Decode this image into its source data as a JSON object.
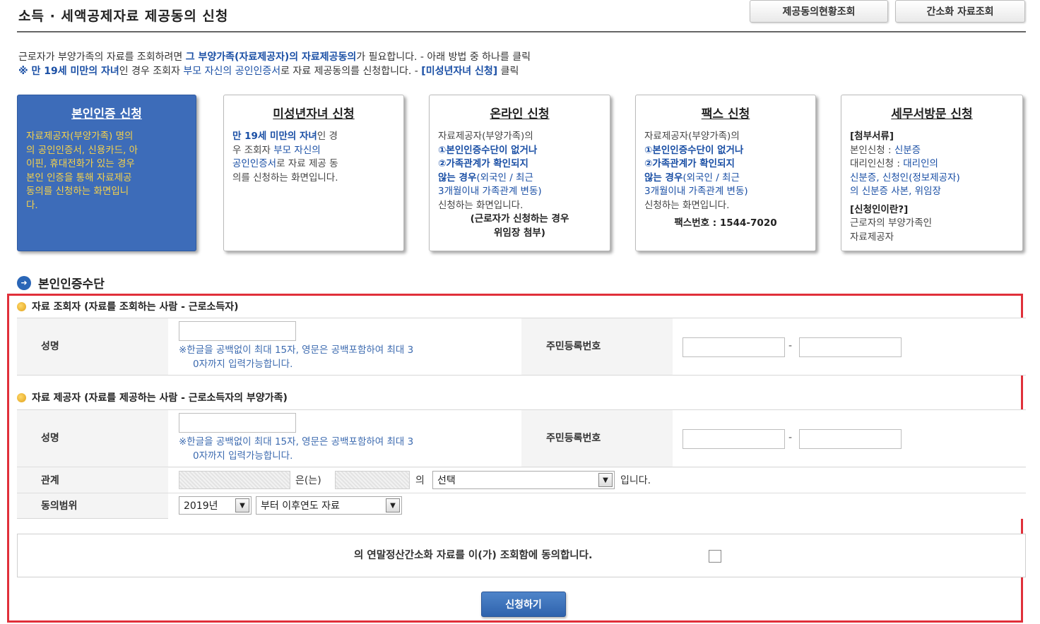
{
  "header": {
    "title": "소득 · 세액공제자료 제공동의 신청",
    "btn_status": "제공동의현황조회",
    "btn_simple": "간소화 자료조회"
  },
  "intro": {
    "line1_a": "근로자가 부양가족의 자료를 조회하려면 ",
    "line1_b": "그 부양가족(자료제공자)의 자료제공동의",
    "line1_c": "가 필요합니다. - 아래 방법 중 하나를 클릭",
    "line2_a": "※ 만 19세 미만의 자녀",
    "line2_b": "인 경우 조회자 ",
    "line2_c": "부모 자신의 공인인증서",
    "line2_d": "로 자료 제공동의를 신청합니다. - ",
    "line2_e": "[미성년자녀 신청]",
    "line2_f": " 클릭"
  },
  "cards": {
    "self": {
      "title": "본인인증 신청",
      "l1": "자료제공자(부양가족) 명의",
      "l2": "의 공인인증서, 신용카드, 아",
      "l3": "이핀, 휴대전화가 있는 경우",
      "l4": "본인 인증을 통해 자료제공",
      "l5": "동의를 신청하는 화면입니",
      "l6": "다."
    },
    "minor": {
      "title": "미성년자녀 신청",
      "l1a": "만 19세 미만의 자녀",
      "l1b": "인 경",
      "l2a": "우 조회자 ",
      "l2b": "부모 자신의",
      "l3a": "공인인증서",
      "l3b": "로 자료 제공 동",
      "l4": "의를 신청하는 화면입니다."
    },
    "online": {
      "title": "온라인 신청",
      "l1": "자료제공자(부양가족)의",
      "l2": "①본인인증수단이 없거나",
      "l3": "②가족관계가 확인되지",
      "l4a": "않는 경우",
      "l4b": "(외국인 / 최근",
      "l5": "3개월이내 가족관계 변동)",
      "l6": "신청하는 화면입니다.",
      "l7": "(근로자가 신청하는 경우",
      "l8": "위임장 첨부)"
    },
    "fax": {
      "title": "팩스 신청",
      "l1": "자료제공자(부양가족)의",
      "l2": "①본인인증수단이 없거나",
      "l3": "②가족관계가 확인되지",
      "l4a": "않는 경우",
      "l4b": "(외국인 / 최근",
      "l5": "3개월이내 가족관계 변동)",
      "l6": "신청하는 화면입니다.",
      "l7": "팩스번호 : 1544-7020"
    },
    "visit": {
      "title": "세무서방문 신청",
      "l1": "[첨부서류]",
      "l2a": "본인신청 : ",
      "l2b": "신분증",
      "l3a": "대리인신청 : ",
      "l3b": "대리인의",
      "l4": "신분증, 신청인(정보제공자)",
      "l5": "의 신분증 사본, 위임장",
      "l6": "[신청인이란?]",
      "l7": "근로자의 부양가족인",
      "l8": "자료제공자"
    }
  },
  "section": {
    "title": "본인인증수단",
    "viewer_head": "자료 조회자 (자료를 조회하는 사람 - 근로소득자)",
    "provider_head": "자료 제공자 (자료를 제공하는 사람 - 근로소득자의 부양가족)",
    "name_label": "성명",
    "rrn_label": "주민등록번호",
    "hint_l1": "※한글을 공백없이 최대 15자, 영문은 공백포함하여 최대 3",
    "hint_l2": "0자까지 입력가능합니다.",
    "dash": "-",
    "relation_label": "관계",
    "relation_eun": "은(는)",
    "relation_ui": "의",
    "relation_select": "선택",
    "relation_end": "입니다.",
    "range_label": "동의범위",
    "year_select": "2019년",
    "range_select": "부터 이후연도 자료",
    "agree_text": "의 연말정산간소화 자료를 이(가) 조회함에 동의합니다.",
    "submit": "신청하기"
  }
}
